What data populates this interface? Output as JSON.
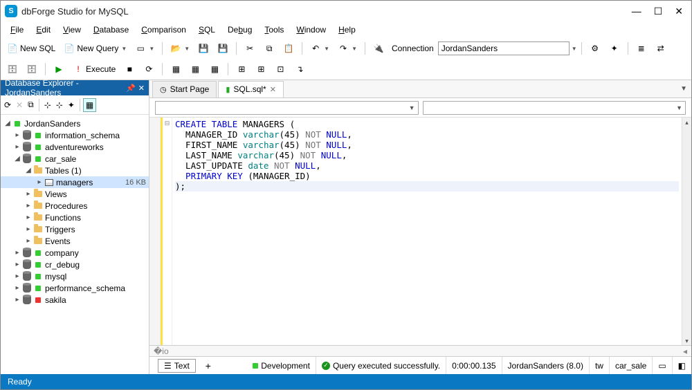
{
  "window": {
    "title": "dbForge Studio for MySQL"
  },
  "menu": [
    {
      "label": "File",
      "ul": "F"
    },
    {
      "label": "Edit",
      "ul": "E"
    },
    {
      "label": "View",
      "ul": "V"
    },
    {
      "label": "Database",
      "ul": "D"
    },
    {
      "label": "Comparison",
      "ul": "C"
    },
    {
      "label": "SQL",
      "ul": "S"
    },
    {
      "label": "Debug",
      "ul": "b"
    },
    {
      "label": "Tools",
      "ul": "T"
    },
    {
      "label": "Window",
      "ul": "W"
    },
    {
      "label": "Help",
      "ul": "H"
    }
  ],
  "toolbar1": {
    "new_sql": "New SQL",
    "new_query": "New Query",
    "connection_label": "Connection",
    "connection_value": "JordanSanders"
  },
  "toolbar2": {
    "execute": "Execute"
  },
  "sidebar": {
    "title": "Database Explorer - JordanSanders",
    "root": {
      "label": "JordanSanders"
    },
    "dbs": [
      {
        "label": "information_schema",
        "status": "green"
      },
      {
        "label": "adventureworks",
        "status": "green"
      },
      {
        "label": "car_sale",
        "status": "green",
        "expanded": true
      },
      {
        "label": "company",
        "status": "green"
      },
      {
        "label": "cr_debug",
        "status": "green"
      },
      {
        "label": "mysql",
        "status": "green"
      },
      {
        "label": "performance_schema",
        "status": "green"
      },
      {
        "label": "sakila",
        "status": "red"
      }
    ],
    "car_sale_children": {
      "tables_label": "Tables (1)",
      "table": {
        "label": "managers",
        "size": "16 KB"
      },
      "folders": [
        "Views",
        "Procedures",
        "Functions",
        "Triggers",
        "Events"
      ]
    }
  },
  "tabs": {
    "start": "Start Page",
    "sql": "SQL.sql*"
  },
  "sql": {
    "l1a": "CREATE",
    "l1b": " TABLE",
    "l1c": " MANAGERS ",
    "l2a": "  MANAGER_ID ",
    "l2b": "varchar",
    "l2c": "(45)",
    "l2d": " NOT",
    "l2e": " NULL",
    "l2f": ",",
    "l3a": "  FIRST_NAME ",
    "l3b": "varchar",
    "l3c": "(45)",
    "l3d": " NOT",
    "l3e": " NULL",
    "l3f": ",",
    "l4a": "  LAST_NAME ",
    "l4b": "varchar",
    "l4c": "(45)",
    "l4d": " NOT",
    "l4e": " NULL",
    "l4f": ",",
    "l5a": "  LAST_UPDATE ",
    "l5b": "date",
    "l5c": " NOT",
    "l5d": " NULL",
    "l5e": ",",
    "l6a": "  PRIMARY",
    "l6b": " KEY",
    "l6c": " (MANAGER_ID)",
    "l7": ");"
  },
  "bottom": {
    "text_tab": "Text",
    "env": "Development",
    "status": "Query executed successfully.",
    "time": "0:00:00.135",
    "conn": "JordanSanders (8.0)",
    "user": "tw",
    "db": "car_sale"
  },
  "status_bar": {
    "text": "Ready"
  }
}
